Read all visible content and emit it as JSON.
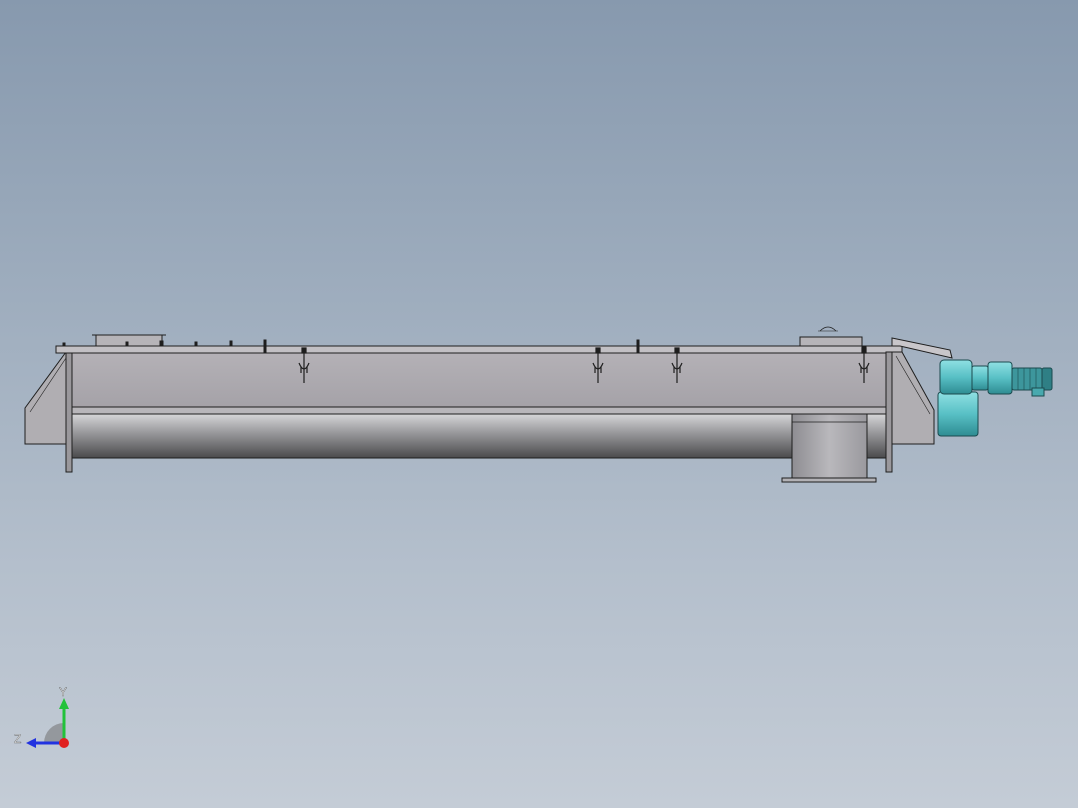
{
  "viewport": {
    "background_top": "#8799ae",
    "background_bottom": "#c4ccd6",
    "model_edge_color": "#1e1e1e",
    "body_color": "#a9a6ab",
    "motor_color": "#5fc4c9"
  },
  "triad": {
    "y_label": "Y",
    "z_label": "Z",
    "y_color": "#22c23a",
    "z_color": "#2233e0",
    "x_color": "#e02020"
  }
}
